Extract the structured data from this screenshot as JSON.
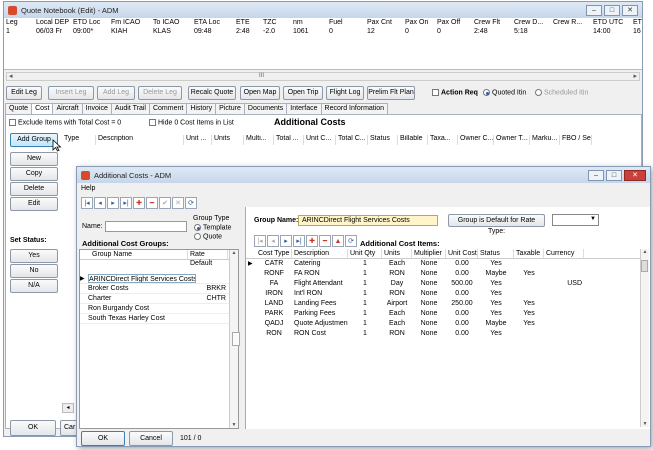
{
  "main": {
    "title": "Quote Notebook (Edit) - ADM",
    "leg_cols": [
      "Leg",
      "Local DEP",
      "ETD Loc",
      "Fm ICAO",
      "To ICAO",
      "ETA Loc",
      "ETE",
      "TZC",
      "nm",
      "Fuel",
      "Pax Cnt",
      "Pax On",
      "Pax Off",
      "Crew Flt",
      "Crew D...",
      "Crew R...",
      "ETD UTC",
      "ET"
    ],
    "leg_row": [
      "1",
      "06/03 Fr",
      "09:00*",
      "KIAH",
      "KLAS",
      "09:48",
      "2:48",
      "-2.0",
      "1061",
      "0",
      "12",
      "0",
      "0",
      "2:48",
      "5:18",
      "",
      "14:00",
      "16"
    ],
    "hscroll_mark": "III",
    "toolbar": [
      "Edit Leg",
      "Insert Leg",
      "Add Leg",
      "Delete Leg",
      "Recalc Quote",
      "Open Map",
      "Open Trip",
      "Flight Log",
      "Prelim Flt Plan"
    ],
    "action_req": "Action Req",
    "quoted_itin": "Quoted Itin",
    "scheduled_itin": "Scheduled Itin",
    "tabs": [
      "Quote",
      "Cost",
      "Aircraft",
      "Invoice",
      "Audit Trail",
      "Comment",
      "History",
      "Picture",
      "Documents",
      "Interface",
      "Record Information"
    ],
    "exclude_label": "Exclude Items with Total Cost = 0",
    "hide_label": "Hide 0 Cost Items in List",
    "additional_costs": "Additional Costs",
    "add_group": "Add Group",
    "cost_cols": [
      "Type",
      "Description",
      "Unit ...",
      "Units",
      "Multi...",
      "Total ...",
      "Unit C...",
      "Total C...",
      "Status",
      "Billable",
      "Taxa...",
      "Owner C...",
      "Owner T...",
      "Marku...",
      "FBO / Ser"
    ],
    "side_buttons": [
      "New",
      "Copy",
      "Delete",
      "Edit"
    ],
    "set_status": "Set Status:",
    "status_buttons": [
      "Yes",
      "No",
      "N/A"
    ],
    "ok": "OK",
    "cancel_partial": "Car"
  },
  "dialog": {
    "title": "Additional Costs - ADM",
    "menu": "Help",
    "name_label": "Name:",
    "group_type": "Group Type",
    "template": "Template",
    "quote": "Quote",
    "groups_heading": "Additional Cost Groups:",
    "group_cols": [
      "Group Name",
      "Rate Default"
    ],
    "groups": [
      {
        "name": "ARINCDirect Flight Services Costs",
        "rate": ""
      },
      {
        "name": "Broker Costs",
        "rate": "BRKR"
      },
      {
        "name": "Charter",
        "rate": "CHTR"
      },
      {
        "name": "Ron Burgandy Cost",
        "rate": ""
      },
      {
        "name": "South Texas Harley Cost",
        "rate": ""
      }
    ],
    "group_name_label": "Group Name:",
    "group_name_value": "ARINCDirect Flight Services Costs",
    "default_btn": "Group is Default for Rate Type:",
    "items_heading": "Additional Cost Items:",
    "item_cols": [
      "Cost Type",
      "Description",
      "Unit Qty",
      "Units",
      "Multiplier",
      "Unit Cost",
      "Status",
      "Taxable",
      "Currency"
    ],
    "items": [
      [
        "CATR",
        "Catering",
        "1",
        "Each",
        "None",
        "0.00",
        "Yes",
        "",
        ""
      ],
      [
        "RONF",
        "FA RON",
        "1",
        "RON",
        "None",
        "0.00",
        "Maybe",
        "Yes",
        ""
      ],
      [
        "FA",
        "Flight Attendant",
        "1",
        "Day",
        "None",
        "500.00",
        "Yes",
        "",
        "USD"
      ],
      [
        "IRON",
        "Int'l RON",
        "1",
        "RON",
        "None",
        "0.00",
        "Yes",
        "",
        ""
      ],
      [
        "LAND",
        "Landing Fees",
        "1",
        "Airport",
        "None",
        "250.00",
        "Yes",
        "Yes",
        ""
      ],
      [
        "PARK",
        "Parking Fees",
        "1",
        "Each",
        "None",
        "0.00",
        "Yes",
        "Yes",
        ""
      ],
      [
        "QADJ",
        "Quote Adjustment",
        "1",
        "Each",
        "None",
        "0.00",
        "Maybe",
        "Yes",
        ""
      ],
      [
        "RON",
        "RON Cost",
        "1",
        "RON",
        "None",
        "0.00",
        "Yes",
        "",
        ""
      ]
    ],
    "ok": "OK",
    "cancel": "Cancel",
    "count": "101 / 0"
  }
}
